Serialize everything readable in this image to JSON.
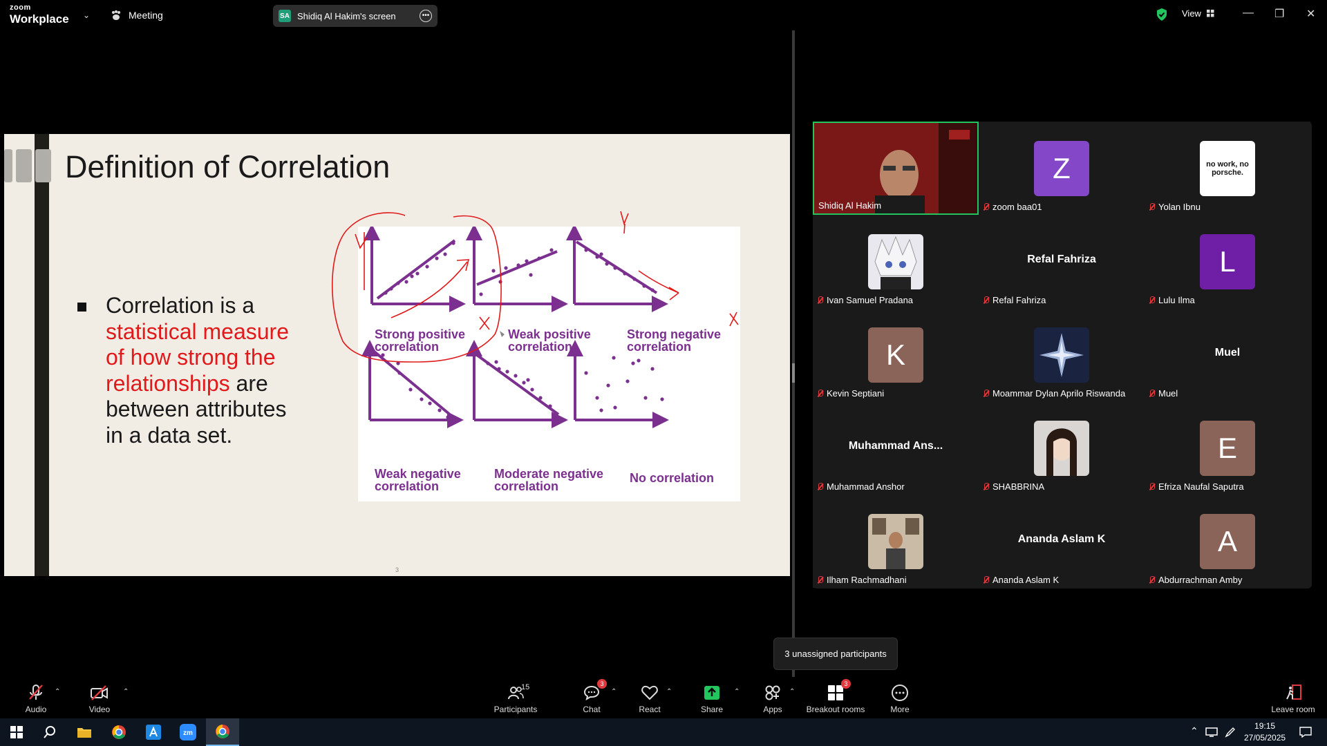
{
  "app": {
    "brand_small": "zoom",
    "brand_name": "Workplace"
  },
  "titlebar": {
    "meeting_label": "Meeting",
    "screen_initials": "SA",
    "screen_title": "Shidiq Al Hakim's screen",
    "view_label": "View"
  },
  "slide": {
    "title": "Definition of Correlation",
    "bullet": {
      "term": "Correlation",
      "part1": " is a ",
      "highlight1": "statistical measure of how strong the relationships",
      "part2": " are between attributes in a data set."
    },
    "figure_labels": {
      "strong_positive_1": "Strong positive",
      "strong_positive_2": "correlation",
      "weak_positive_1": "Weak positive",
      "weak_positive_2": "correlation",
      "strong_negative_1": "Strong negative",
      "strong_negative_2": "correlation",
      "weak_negative_1": "Weak negative",
      "weak_negative_2": "correlation",
      "moderate_negative_1": "Moderate negative",
      "moderate_negative_2": "correlation",
      "no_correlation": "No correlation"
    },
    "page_number": "3"
  },
  "participants": [
    {
      "name": "Shidiq Al Hakim",
      "type": "video"
    },
    {
      "name": "zoom baa01",
      "initial": "Z",
      "color": "#8347c7"
    },
    {
      "name": "Yolan Ibnu",
      "type": "image",
      "caption": "no work, no porsche."
    },
    {
      "name": "Ivan Samuel Pradana",
      "type": "image"
    },
    {
      "name": "Refal Fahriza",
      "display": "Refal Fahriza"
    },
    {
      "name": "Lulu Ilma",
      "initial": "L",
      "color": "#6e1fa6"
    },
    {
      "name": "Kevin Septiani",
      "initial": "K",
      "color": "#8b6459"
    },
    {
      "name": "Moammar Dylan Aprilo Riswanda",
      "type": "image"
    },
    {
      "name": "Muel",
      "display": "Muel"
    },
    {
      "name": "Muhammad Anshor",
      "display": "Muhammad  Ans..."
    },
    {
      "name": "SHABBRINA",
      "type": "image"
    },
    {
      "name": "Efriza Naufal Saputra",
      "initial": "E",
      "color": "#8b6459"
    },
    {
      "name": "Ilham Rachmadhani",
      "type": "image"
    },
    {
      "name": "Ananda Aslam K",
      "display": "Ananda Aslam K"
    },
    {
      "name": "Abdurrachman Amby",
      "initial": "A",
      "color": "#8b6459"
    }
  ],
  "tooltip": "3 unassigned participants",
  "toolbar": {
    "audio": "Audio",
    "video": "Video",
    "participants": "Participants",
    "participants_count": "15",
    "chat": "Chat",
    "chat_badge": "3",
    "react": "React",
    "share": "Share",
    "apps": "Apps",
    "breakout": "Breakout rooms",
    "breakout_badge": "3",
    "more": "More",
    "leave": "Leave room"
  },
  "taskbar": {
    "time": "19:15",
    "date": "27/05/2025"
  },
  "colors": {
    "accent_green": "#22c55e",
    "badge_red": "#e0393e",
    "purple": "#7b2f8e"
  }
}
